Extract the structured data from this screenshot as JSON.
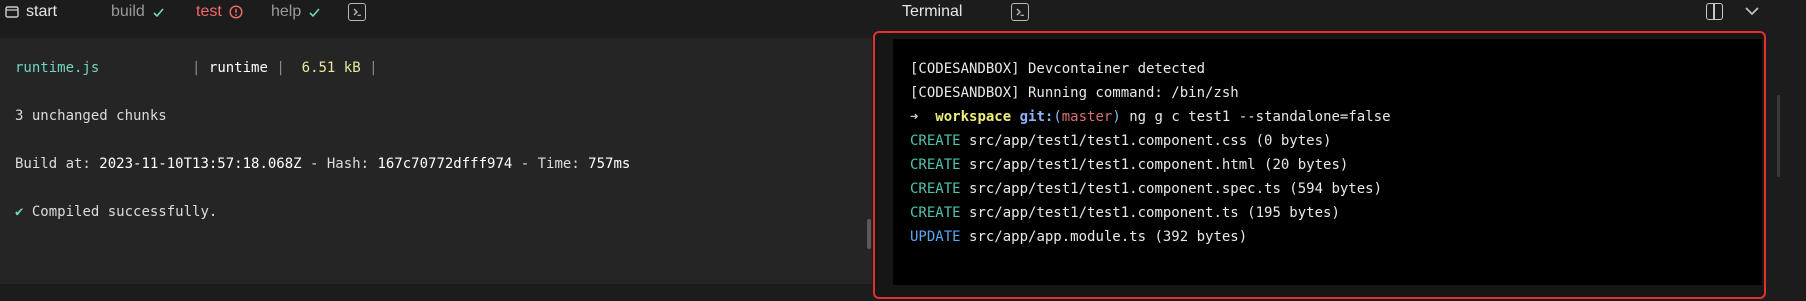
{
  "tabs": [
    {
      "label": "start",
      "icon": "terminal-window-icon"
    },
    {
      "label": "build",
      "status": "success",
      "icon": "check-icon"
    },
    {
      "label": "test",
      "status": "error",
      "icon": "alert-circle-icon"
    },
    {
      "label": "help",
      "status": "success",
      "icon": "check-icon"
    }
  ],
  "colors": {
    "error": "#f16b6b",
    "success": "#6fd6c0",
    "focus_border": "#e0322a",
    "create": "#4fc4b0",
    "update": "#5aa8f0",
    "workspace": "#f1ee7a"
  },
  "output": {
    "file_name": "runtime.js",
    "chunk_name": "runtime",
    "file_size": "6.51 kB",
    "unchanged_chunks": "3 unchanged chunks",
    "build_prefix": "Build at: ",
    "build_time": "2023-11-10T13:57:18.068Z",
    "hash_prefix": " - Hash: ",
    "hash": "167c70772dfff974",
    "time_prefix": " - Time: ",
    "duration": "757ms",
    "check_mark": "✔",
    "compiled": "Compiled successfully."
  },
  "terminal": {
    "title": "Terminal",
    "line1": "[CODESANDBOX] Devcontainer detected",
    "line2": "[CODESANDBOX] Running command: /bin/zsh",
    "prompt_arrow": "➜",
    "prompt_dir": "workspace",
    "git_label": "git:",
    "branch": "master",
    "command": "ng g c test1 --standalone=false",
    "file_ops": [
      {
        "action": "CREATE",
        "text": "src/app/test1/test1.component.css (0 bytes)"
      },
      {
        "action": "CREATE",
        "text": "src/app/test1/test1.component.html (20 bytes)"
      },
      {
        "action": "CREATE",
        "text": "src/app/test1/test1.component.spec.ts (594 bytes)"
      },
      {
        "action": "CREATE",
        "text": "src/app/test1/test1.component.ts (195 bytes)"
      },
      {
        "action": "UPDATE",
        "text": "src/app/app.module.ts (392 bytes)"
      }
    ]
  }
}
